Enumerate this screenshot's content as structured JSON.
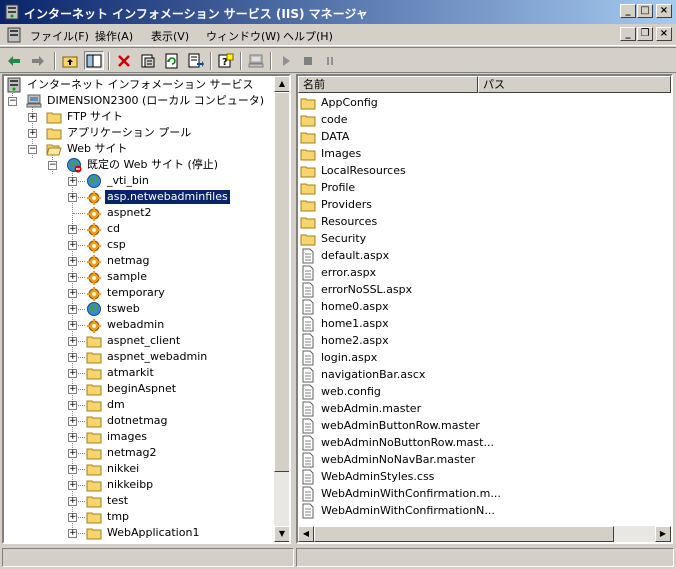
{
  "window": {
    "title": "インターネット インフォメーション サービス (IIS) マネージャ",
    "minimize": "_",
    "maximize": "□",
    "close": "×"
  },
  "menu": {
    "items": [
      "ファイル(F)",
      "操作(A)",
      "表示(V)",
      "ウィンドウ(W)",
      "ヘルプ(H)"
    ]
  },
  "tree": {
    "root": "インターネット インフォメーション サービス",
    "computer": "DIMENSION2300 (ローカル コンピュータ)",
    "ftp": "FTP サイト",
    "apppool": "アプリケーション プール",
    "web": "Web サイト",
    "defaultsite": "既定の Web サイト (停止)",
    "children": [
      "_vti_bin",
      "asp.netwebadminfiles",
      "aspnet2",
      "cd",
      "csp",
      "netmag",
      "sample",
      "temporary",
      "tsweb",
      "webadmin",
      "aspnet_client",
      "aspnet_webadmin",
      "atmarkit",
      "beginAspnet",
      "dm",
      "dotnetmag",
      "images",
      "netmag2",
      "nikkei",
      "nikkeibp",
      "test",
      "tmp",
      "WebApplication1"
    ],
    "selected": "asp.netwebadminfiles"
  },
  "list": {
    "col_name": "名前",
    "col_path": "パス",
    "folders": [
      "AppConfig",
      "code",
      "DATA",
      "Images",
      "LocalResources",
      "Profile",
      "Providers",
      "Resources",
      "Security"
    ],
    "files": [
      "default.aspx",
      "error.aspx",
      "errorNoSSL.aspx",
      "home0.aspx",
      "home1.aspx",
      "home2.aspx",
      "login.aspx",
      "navigationBar.ascx",
      "web.config",
      "webAdmin.master",
      "webAdminButtonRow.master",
      "webAdminNoButtonRow.mast...",
      "webAdminNoNavBar.master",
      "WebAdminStyles.css",
      "WebAdminWithConfirmation.m...",
      "WebAdminWithConfirmationN..."
    ]
  },
  "colors": {
    "title_start": "#0a246a",
    "title_end": "#a6caf0",
    "selection": "#0a246a",
    "folder": "#f7d56a",
    "face": "#d4d0c8"
  }
}
